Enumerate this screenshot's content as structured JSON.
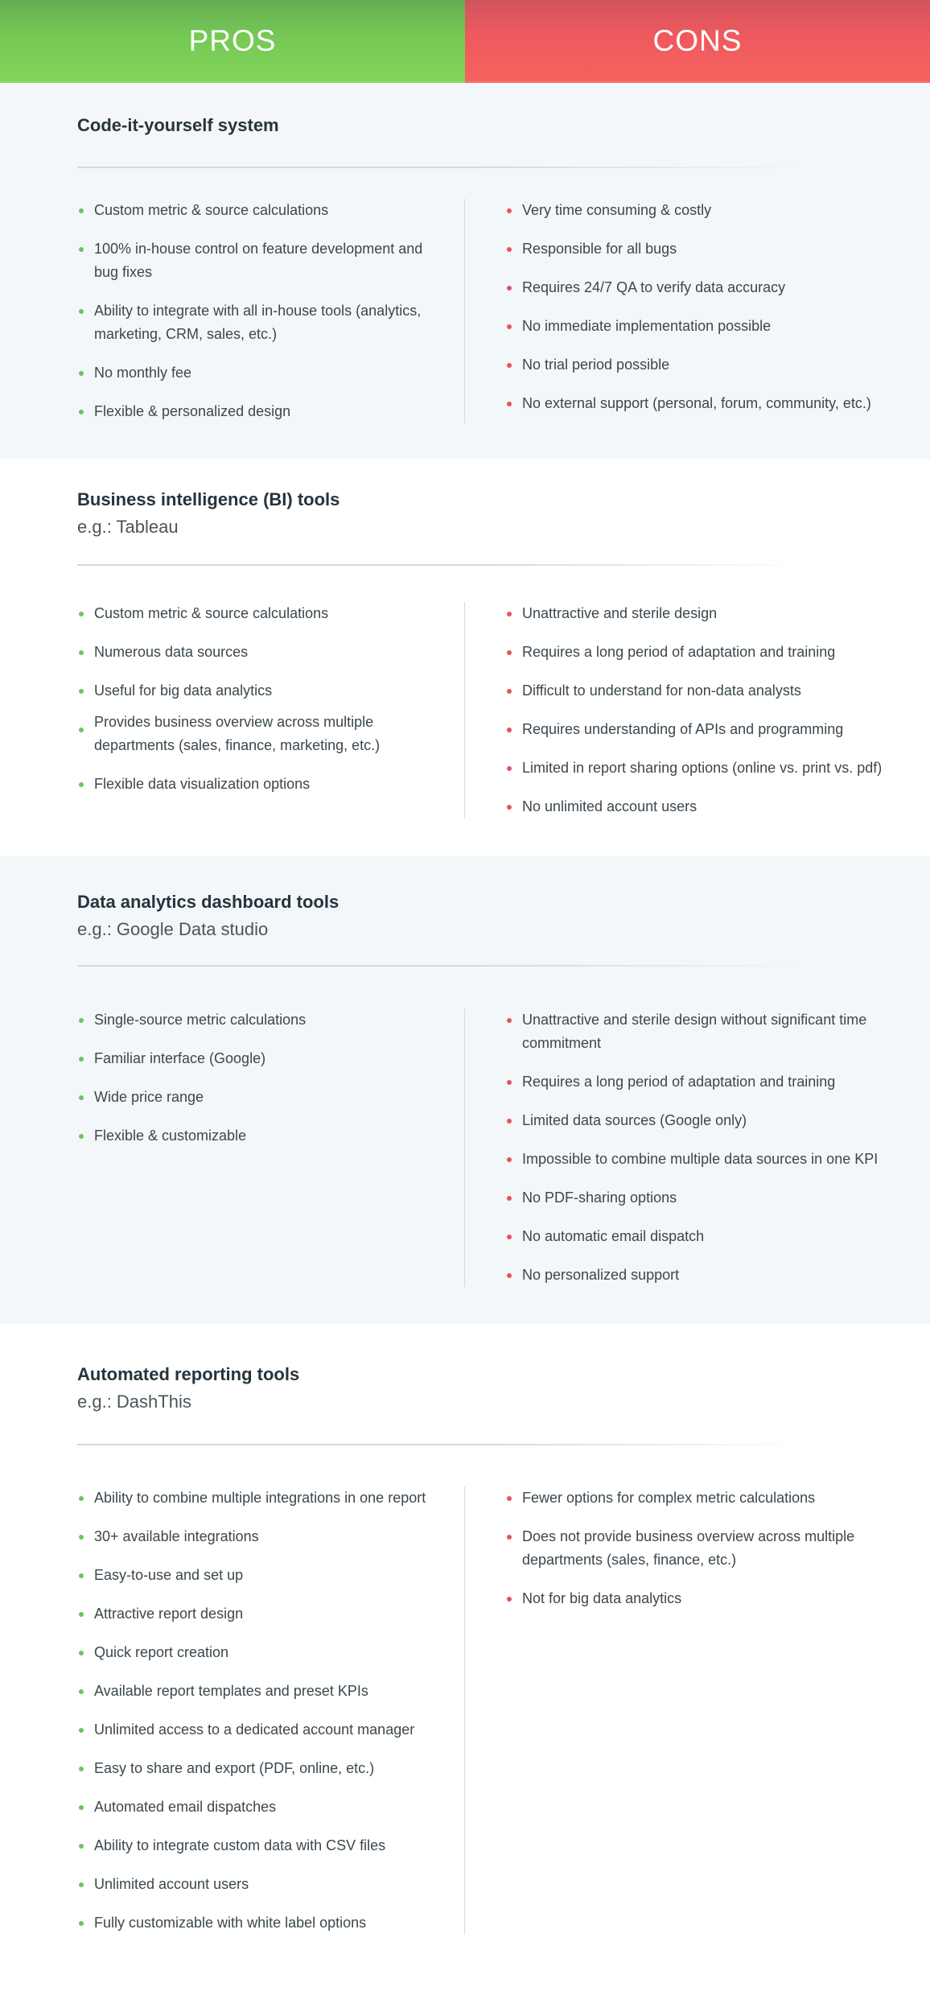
{
  "header": {
    "pros_label": "PROS",
    "cons_label": "CONS",
    "pros_color": "#76c955",
    "cons_color": "#f05b5e"
  },
  "sections": [
    {
      "title": "Code-it-yourself system",
      "subtitle": "",
      "pros": [
        "Custom metric & source calculations",
        "100% in-house control on feature development and bug fixes",
        "Ability to integrate with all in-house tools (analytics, marketing, CRM, sales, etc.)",
        "No monthly fee",
        "Flexible & personalized design"
      ],
      "cons": [
        "Very time consuming & costly",
        "Responsible for all bugs",
        "Requires 24/7 QA to verify data accuracy",
        "No immediate implementation possible",
        "No trial period possible",
        "No external support (personal, forum, community, etc.)"
      ]
    },
    {
      "title": "Business intelligence (BI) tools",
      "subtitle": "e.g.: Tableau",
      "pros": [
        "Custom metric & source calculations",
        "Numerous data sources",
        "Useful for big data analytics",
        "Provides business overview across multiple departments (sales, finance, marketing, etc.)",
        "Flexible data visualization options"
      ],
      "cons": [
        "Unattractive and sterile design",
        "Requires a long period of adaptation and training",
        "Difficult to understand for non-data analysts",
        "Requires understanding of APIs and programming",
        "Limited in report sharing options (online vs. print vs. pdf)",
        "No unlimited account users"
      ]
    },
    {
      "title": "Data analytics dashboard tools",
      "subtitle": "e.g.: Google Data studio",
      "pros": [
        "Single-source metric calculations",
        "Familiar interface (Google)",
        "Wide price range",
        "Flexible & customizable"
      ],
      "cons": [
        "Unattractive and sterile design without significant time commitment",
        "Requires a long period of adaptation and training",
        "Limited data sources (Google only)",
        "Impossible to combine multiple data sources in one KPI",
        "No PDF-sharing options",
        "No automatic email dispatch",
        "No personalized support"
      ]
    },
    {
      "title": "Automated reporting tools",
      "subtitle": "e.g.: DashThis",
      "pros": [
        "Ability to combine multiple integrations in one report",
        "30+ available integrations",
        "Easy-to-use and set up",
        "Attractive report design",
        "Quick report creation",
        "Available report templates and preset KPIs",
        "Unlimited access to a dedicated account manager",
        "Easy to share and export (PDF, online, etc.)",
        "Automated email dispatches",
        "Ability to integrate custom data with CSV files",
        "Unlimited account users",
        "Fully customizable with white label options"
      ],
      "cons": [
        "Fewer options for complex metric calculations",
        "Does not provide business overview across multiple departments (sales, finance, etc.)",
        "Not for big data analytics"
      ]
    }
  ]
}
